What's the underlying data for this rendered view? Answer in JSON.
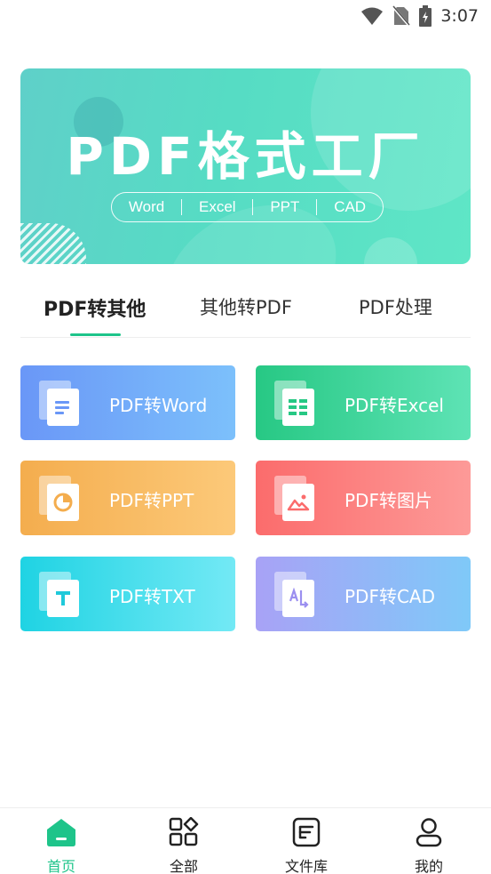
{
  "status_bar": {
    "time": "3:07",
    "icons": [
      "wifi-icon",
      "no-sim-icon",
      "battery-charging-icon"
    ]
  },
  "banner": {
    "title": "PDF格式工厂",
    "formats": [
      "Word",
      "Excel",
      "PPT",
      "CAD"
    ]
  },
  "tabs": [
    {
      "label": "PDF转其他",
      "active": true
    },
    {
      "label": "其他转PDF",
      "active": false
    },
    {
      "label": "PDF处理",
      "active": false
    }
  ],
  "tools": [
    {
      "label": "PDF转Word",
      "icon": "word-doc-icon",
      "color": "#6b9cf8"
    },
    {
      "label": "PDF转Excel",
      "icon": "excel-sheet-icon",
      "color": "#2fcf8a"
    },
    {
      "label": "PDF转PPT",
      "icon": "ppt-pie-icon",
      "color": "#f5b35a"
    },
    {
      "label": "PDF转图片",
      "icon": "image-icon",
      "color": "#fb7b7b"
    },
    {
      "label": "PDF转TXT",
      "icon": "text-t-icon",
      "color": "#35d6e6"
    },
    {
      "label": "PDF转CAD",
      "icon": "cad-icon",
      "color": "#a2a4f5"
    }
  ],
  "bottom_nav": [
    {
      "label": "首页",
      "icon": "home-icon",
      "active": true,
      "accent": "#1ec48a"
    },
    {
      "label": "全部",
      "icon": "grid-all-icon",
      "active": false
    },
    {
      "label": "文件库",
      "icon": "file-library-icon",
      "active": false
    },
    {
      "label": "我的",
      "icon": "profile-icon",
      "active": false
    }
  ]
}
